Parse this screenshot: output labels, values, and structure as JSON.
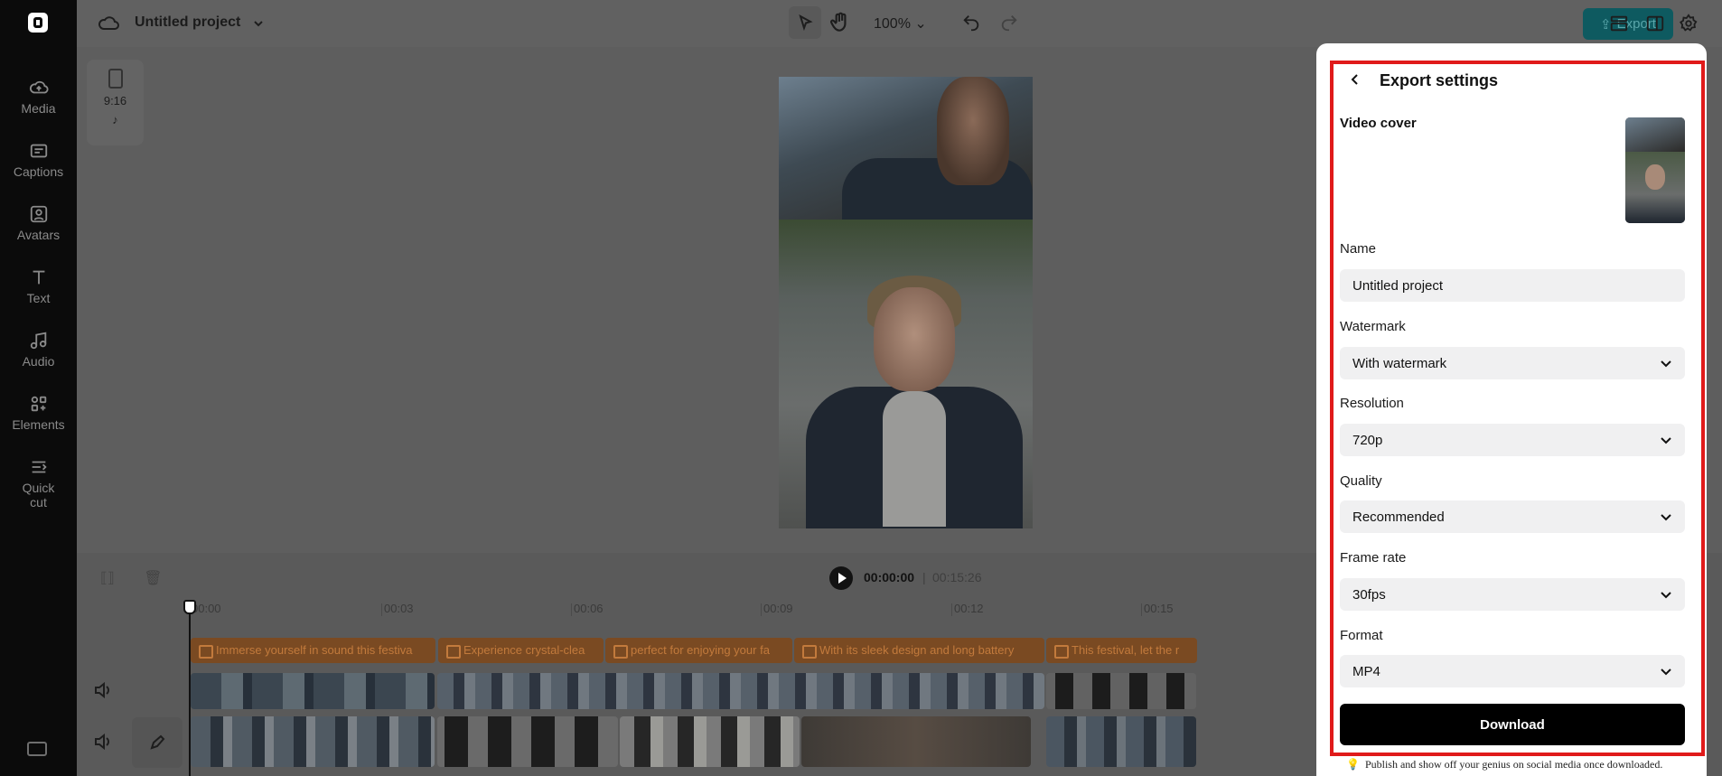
{
  "app": {
    "project_title": "Untitled project",
    "zoom": "100%",
    "export_label": "Export"
  },
  "sidebar": {
    "items": [
      {
        "label": "Media",
        "icon": "cloud-upload-icon"
      },
      {
        "label": "Captions",
        "icon": "captions-icon"
      },
      {
        "label": "Avatars",
        "icon": "avatar-icon"
      },
      {
        "label": "Text",
        "icon": "text-icon"
      },
      {
        "label": "Audio",
        "icon": "music-note-icon"
      },
      {
        "label": "Elements",
        "icon": "elements-icon"
      },
      {
        "label": "Quick cut",
        "icon": "quick-cut-icon"
      }
    ]
  },
  "canvas": {
    "aspect_ratio": "9:16"
  },
  "timeline": {
    "current_time": "00:00:00",
    "separator": "|",
    "total_time": "00:15:26",
    "ticks": [
      "00:00",
      "00:03",
      "00:06",
      "00:09",
      "00:12",
      "00:15"
    ],
    "captions": [
      "Immerse yourself in sound this festiva",
      "Experience crystal-clea",
      "perfect for enjoying your fa",
      "With its sleek design and long battery",
      "This festival, let the r"
    ]
  },
  "export_panel": {
    "title": "Export settings",
    "video_cover_label": "Video cover",
    "name_label": "Name",
    "name_value": "Untitled project",
    "watermark_label": "Watermark",
    "watermark_value": "With watermark",
    "resolution_label": "Resolution",
    "resolution_value": "720p",
    "quality_label": "Quality",
    "quality_value": "Recommended",
    "frame_rate_label": "Frame rate",
    "frame_rate_value": "30fps",
    "format_label": "Format",
    "format_value": "MP4",
    "download_label": "Download",
    "note": "Publish and show off your genius on social media once downloaded."
  },
  "colors": {
    "accent": "#0e5a60",
    "caption_clip": "#7a4a22",
    "highlight": "#e01a1a"
  }
}
